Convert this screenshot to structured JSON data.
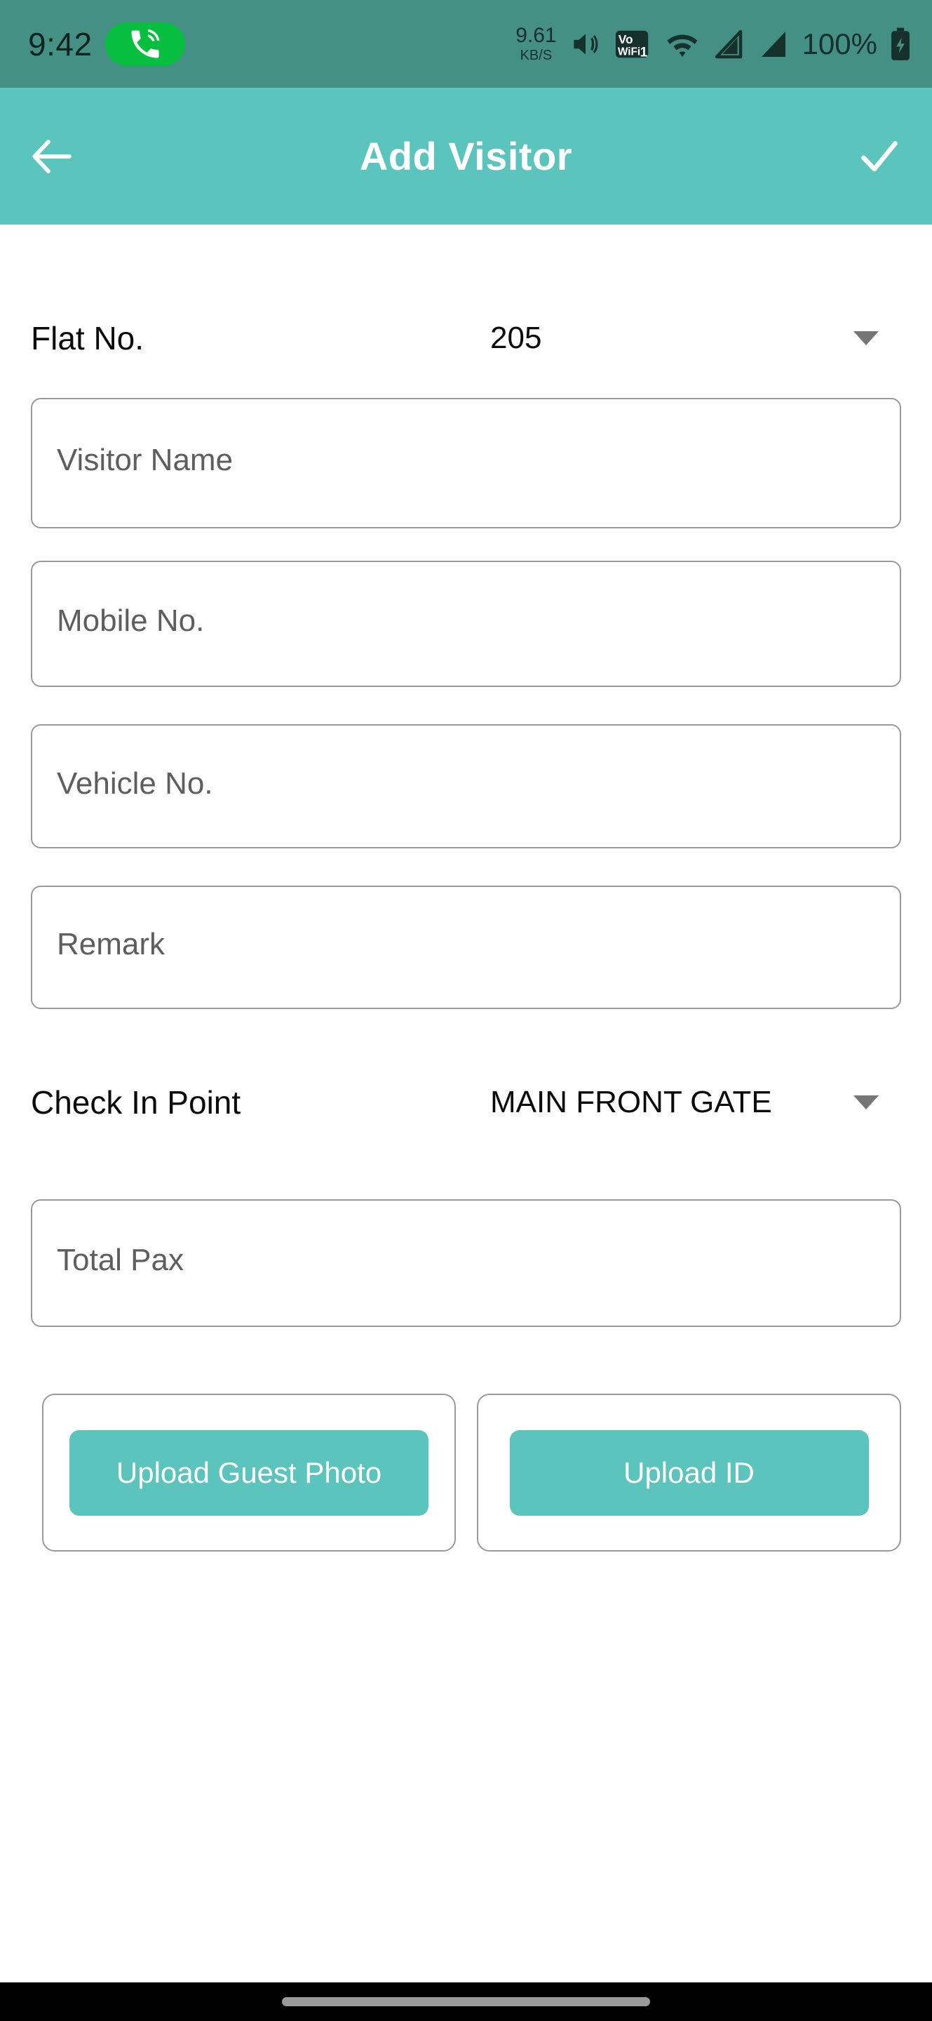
{
  "status_bar": {
    "clock": "9:42",
    "call_icon": "phone-call-icon",
    "net_speed_value": "9.61",
    "net_speed_unit": "KB/S",
    "volume_icon": "volume-icon",
    "vowifi_icon": "vowifi-icon",
    "wifi_icon": "wifi-icon",
    "signal1_icon": "signal-bars-sim1-icon",
    "signal2_icon": "signal-bars-sim2-icon",
    "battery_percent": "100%",
    "battery_icon": "battery-charging-icon",
    "background_color": "#449084"
  },
  "app_bar": {
    "back_icon": "back-arrow-icon",
    "title": "Add Visitor",
    "done_icon": "check-icon",
    "background_color": "#5bc4bc"
  },
  "form": {
    "flat_no": {
      "label": "Flat No.",
      "value": "205",
      "caret_icon": "chevron-down-icon"
    },
    "visitor_name": {
      "placeholder": "Visitor Name",
      "value": ""
    },
    "mobile_no": {
      "placeholder": "Mobile No.",
      "value": ""
    },
    "vehicle_no": {
      "placeholder": "Vehicle No.",
      "value": ""
    },
    "remark": {
      "placeholder": "Remark",
      "value": ""
    },
    "check_in_point": {
      "label": "Check In Point",
      "value": "MAIN FRONT GATE",
      "caret_icon": "chevron-down-icon"
    },
    "total_pax": {
      "placeholder": "Total Pax",
      "value": ""
    },
    "upload_guest_photo": {
      "label": "Upload Guest Photo"
    },
    "upload_id": {
      "label": "Upload ID"
    },
    "accent_color": "#5bc4bc"
  },
  "nav_bar": {
    "gesture_handle": "gesture-pill",
    "background_color": "#000000"
  }
}
